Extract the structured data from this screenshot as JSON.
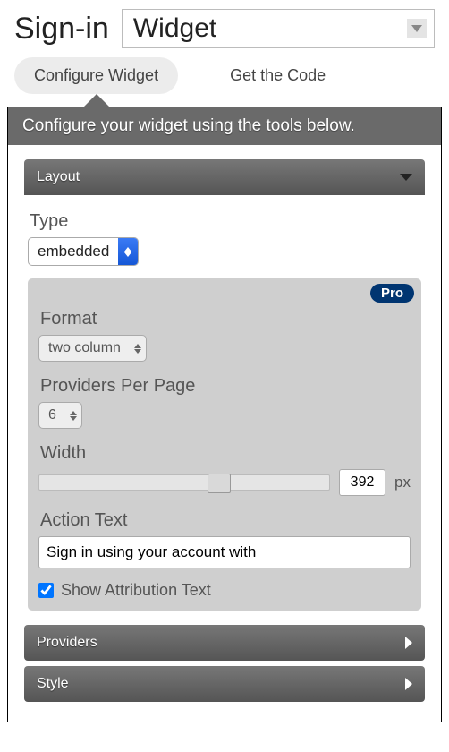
{
  "header": {
    "title": "Sign-in",
    "dropdown_value": "Widget"
  },
  "tabs": {
    "configure": "Configure Widget",
    "getcode": "Get the Code"
  },
  "panel": {
    "banner": "Configure your widget using the tools below."
  },
  "sections": {
    "layout": {
      "title": "Layout"
    },
    "providers": {
      "title": "Providers"
    },
    "style": {
      "title": "Style"
    }
  },
  "layout": {
    "type_label": "Type",
    "type_value": "embedded",
    "pro_badge": "Pro",
    "format_label": "Format",
    "format_value": "two column",
    "ppp_label": "Providers Per Page",
    "ppp_value": "6",
    "width_label": "Width",
    "width_value": "392",
    "width_unit": "px",
    "action_label": "Action Text",
    "action_value": "Sign in using your account with",
    "attribution_label": "Show Attribution Text",
    "attribution_checked": true
  }
}
